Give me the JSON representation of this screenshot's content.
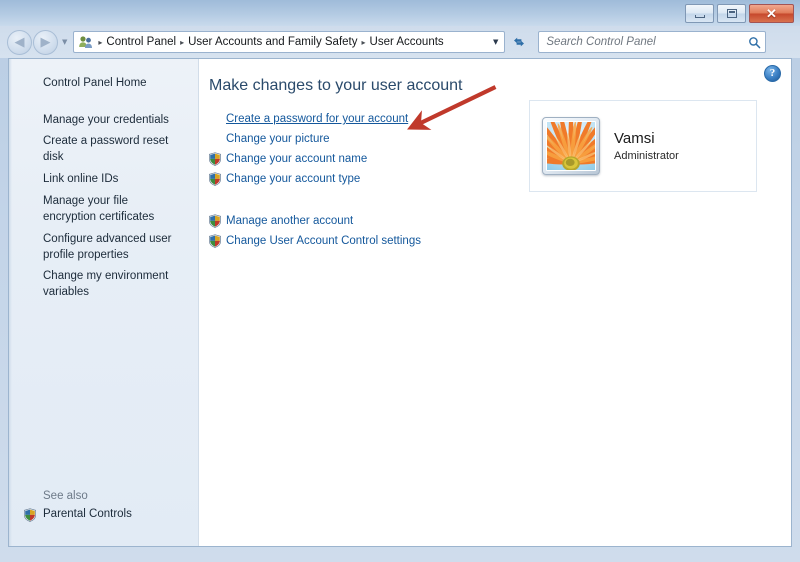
{
  "window": {
    "minimize_label": "Minimize",
    "maximize_label": "Maximize",
    "close_label": "Close",
    "close_glyph": "✕"
  },
  "navigation": {
    "back_label": "Back",
    "back_glyph": "◀",
    "forward_label": "Forward",
    "forward_glyph": "▶",
    "recent_pages_glyph": "▼",
    "refresh_label": "Refresh",
    "dropdown_glyph": "▼",
    "separator_glyph": "▸"
  },
  "breadcrumb": {
    "icon": "user-accounts-icon",
    "items": [
      "Control Panel",
      "User Accounts and Family Safety",
      "User Accounts"
    ]
  },
  "search": {
    "placeholder": "Search Control Panel",
    "value": "",
    "icon": "search-icon"
  },
  "sidebar": {
    "home_label": "Control Panel Home",
    "items": [
      "Manage your credentials",
      "Create a password reset disk",
      "Link online IDs",
      "Manage your file encryption certificates",
      "Configure advanced user profile properties",
      "Change my environment variables"
    ],
    "see_also_label": "See also",
    "see_also_items": [
      {
        "label": "Parental Controls",
        "icon": "uac-shield-icon"
      }
    ]
  },
  "main": {
    "heading": "Make changes to your user account",
    "help_label": "Help",
    "help_glyph": "?",
    "task_groups": [
      {
        "tasks": [
          {
            "label": "Create a password for your account",
            "shield": false,
            "hovered": true
          },
          {
            "label": "Change your picture",
            "shield": false,
            "hovered": false
          },
          {
            "label": "Change your account name",
            "shield": true,
            "hovered": false
          },
          {
            "label": "Change your account type",
            "shield": true,
            "hovered": false
          }
        ]
      },
      {
        "tasks": [
          {
            "label": "Manage another account",
            "shield": true,
            "hovered": false
          },
          {
            "label": "Change User Account Control settings",
            "shield": true,
            "hovered": false
          }
        ]
      }
    ],
    "user_card": {
      "avatar": "flower-avatar-icon",
      "name": "Vamsi",
      "role": "Administrator"
    }
  },
  "annotation": {
    "type": "arrow",
    "color": "#c0392b",
    "points_to": "Create a password for your account"
  },
  "colors": {
    "link": "#14589c",
    "heading": "#2a4a6b",
    "frame": "#b9cde4",
    "annotation_red": "#c0392b"
  }
}
